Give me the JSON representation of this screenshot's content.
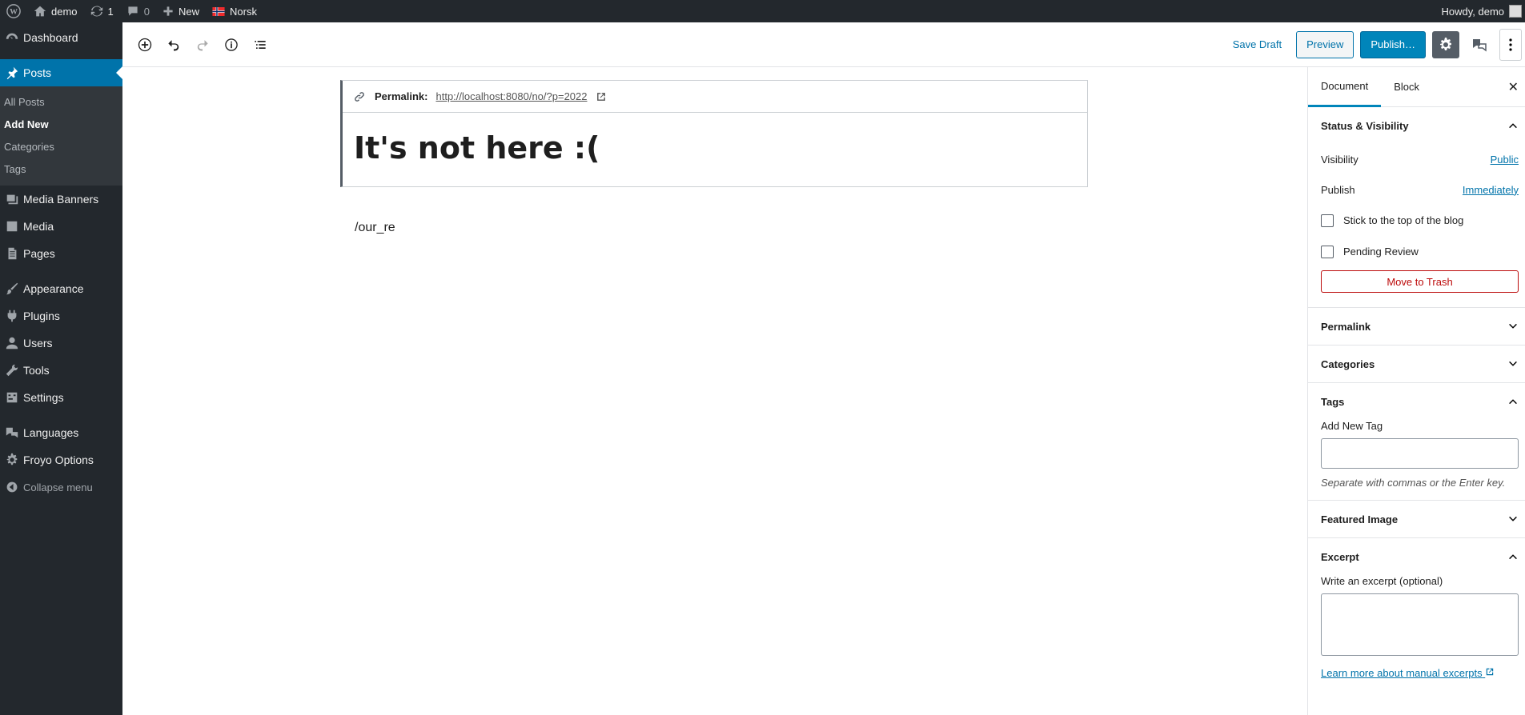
{
  "adminbar": {
    "site": "demo",
    "updates": "1",
    "comments": "0",
    "new_label": "New",
    "language": "Norsk",
    "greeting": "Howdy, demo"
  },
  "sidebar": {
    "dashboard": "Dashboard",
    "posts": "Posts",
    "posts_sub": [
      "All Posts",
      "Add New",
      "Categories",
      "Tags"
    ],
    "media_banners": "Media Banners",
    "media": "Media",
    "pages": "Pages",
    "appearance": "Appearance",
    "plugins": "Plugins",
    "users": "Users",
    "tools": "Tools",
    "settings": "Settings",
    "languages": "Languages",
    "froyo": "Froyo Options",
    "collapse": "Collapse menu"
  },
  "toolbar": {
    "save_draft": "Save Draft",
    "preview": "Preview",
    "publish": "Publish…"
  },
  "editor": {
    "permalink_label": "Permalink:",
    "permalink_url": "http://localhost:8080/no/?p=2022",
    "title": "It's not here :(",
    "content": "/our_re"
  },
  "panel": {
    "tab_document": "Document",
    "tab_block": "Block",
    "status_title": "Status & Visibility",
    "visibility_label": "Visibility",
    "visibility_value": "Public",
    "publish_label": "Publish",
    "publish_value": "Immediately",
    "sticky_label": "Stick to the top of the blog",
    "pending_label": "Pending Review",
    "trash_label": "Move to Trash",
    "permalink_title": "Permalink",
    "categories_title": "Categories",
    "tags_title": "Tags",
    "add_tag_label": "Add New Tag",
    "tag_hint": "Separate with commas or the Enter key.",
    "featured_title": "Featured Image",
    "excerpt_title": "Excerpt",
    "excerpt_label": "Write an excerpt (optional)",
    "learn_more": "Learn more about manual excerpts"
  }
}
